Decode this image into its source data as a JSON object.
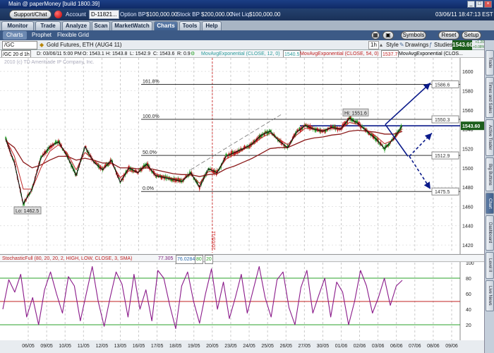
{
  "window": {
    "title": "Main @ paperMoney [build 1800.39]",
    "min": "_",
    "max": "□",
    "close": "×"
  },
  "account": {
    "support_label": "Support/Chat",
    "account_label": "Account",
    "account_value": "D-11821...",
    "option_bp_label": "Option BP",
    "option_bp_value": "$100,000.00",
    "stock_bp_label": "Stock BP",
    "stock_bp_value": "$200,000.00",
    "net_liq_label": "Net Liq",
    "net_liq_value": "$100,000.00",
    "datetime": "03/06/11 18:47:13 EST"
  },
  "tabs": [
    "Monitor",
    "Trade",
    "Analyze",
    "Scan",
    "MarketWatch",
    "Charts",
    "Tools",
    "Help"
  ],
  "active_tab": "Charts",
  "subtabs": [
    "Charts",
    "Prophet",
    "Flexible Grid"
  ],
  "right_buttons": {
    "symbols": "Symbols",
    "reset": "Reset",
    "setup": "Setup"
  },
  "toolbar": {
    "symbol": "/GC",
    "description": "Gold Futures, ETH (AUG4 11)",
    "timeframe": "1h",
    "style": "Style",
    "drawings": "Drawings",
    "studies": "Studies",
    "price": "1543.60",
    "change_up": "+1.20",
    "change_pct": "+0.08%"
  },
  "studyline": {
    "header": "/GC 20 d 1h",
    "date": "D: 03/06/11 5:00 PM",
    "open": "O: 1543.1",
    "high": "H: 1543.8",
    "low": "L: 1542.9",
    "close": "C: 1543.6",
    "range": "R: 0.9",
    "ema12_label": "MovAvgExponential (CLOSE, 12, 0)",
    "ema12_val": "1540.5",
    "ema54_label": "MovAvgExponential (CLOSE, 54, 0)",
    "ema54_val": "1537.7",
    "ema_more_label": "MovAvgExponential (CLOS..."
  },
  "copyright": "2010 (c) TD Ameritrade IP Company, Inc.",
  "annotations": {
    "fib_top": "161.8%",
    "fib_100": "100.0%",
    "fib_50": "50.0%",
    "fib_0": "0.0%",
    "low_label": "Lo: 1462.5",
    "high_label": "Hi: 1551.6",
    "vline_date": "20/05/11"
  },
  "level_tags": [
    "1586.6",
    "1550.3",
    "1512.9",
    "1475.5"
  ],
  "stoch_label": {
    "name": "StochasticFull (80, 20, 20, 2, HIGH, LOW, CLOSE, 3, SMA)",
    "k": "77.305",
    "d": "76.0284",
    "ob": "80",
    "os": "20"
  },
  "sidebar": [
    "Trade",
    "Times and Sales",
    "Active Trader",
    "Big Buttons",
    "Chart",
    "Dashboard",
    "Level II",
    "Live News"
  ],
  "chart_data": {
    "type": "candlestick",
    "x_ticks": [
      "06/05",
      "09/05",
      "10/05",
      "11/05",
      "12/05",
      "13/05",
      "16/05",
      "17/05",
      "18/05",
      "19/05",
      "20/05",
      "23/05",
      "24/05",
      "25/05",
      "26/05",
      "27/05",
      "30/05",
      "01/06",
      "02/06",
      "03/06",
      "06/06",
      "07/06",
      "08/06",
      "09/06"
    ],
    "y_ticks": [
      1420,
      1440,
      1460,
      1480,
      1500,
      1520,
      1540,
      1560,
      1580,
      1600
    ],
    "ylim": [
      1412,
      1614
    ],
    "fib_levels": [
      1586.6,
      1550.3,
      1512.9,
      1475.5
    ],
    "current_price": 1543.6,
    "price_path": [
      1530,
      1505,
      1462.5,
      1478,
      1510,
      1522,
      1527,
      1512,
      1492,
      1522,
      1506,
      1498,
      1508,
      1485,
      1500,
      1495,
      1504,
      1492,
      1490,
      1488,
      1486,
      1495,
      1480,
      1499,
      1495,
      1512,
      1516,
      1520,
      1525,
      1534,
      1538,
      1528,
      1521,
      1537,
      1544,
      1540,
      1538,
      1542,
      1540,
      1551.6,
      1546,
      1538,
      1530,
      1520,
      1530,
      1543.6
    ],
    "ema12_path": [
      1530,
      1512,
      1478,
      1478,
      1500,
      1517,
      1524,
      1515,
      1498,
      1516,
      1508,
      1500,
      1505,
      1490,
      1497,
      1495,
      1502,
      1494,
      1491,
      1489,
      1488,
      1493,
      1484,
      1496,
      1496,
      1509,
      1514,
      1519,
      1524,
      1531,
      1536,
      1530,
      1524,
      1534,
      1541,
      1540,
      1539,
      1541,
      1540,
      1547,
      1545,
      1539,
      1533,
      1525,
      1529,
      1540.5
    ],
    "ema54_path": [
      1528,
      1521,
      1506,
      1500,
      1503,
      1508,
      1512,
      1512,
      1508,
      1510,
      1508,
      1505,
      1505,
      1500,
      1500,
      1499,
      1500,
      1498,
      1496,
      1494,
      1493,
      1493,
      1491,
      1493,
      1494,
      1499,
      1502,
      1506,
      1510,
      1515,
      1520,
      1521,
      1521,
      1525,
      1529,
      1531,
      1532,
      1534,
      1535,
      1538,
      1539,
      1538,
      1537,
      1535,
      1535,
      1537.7
    ],
    "stoch_ylim": [
      0,
      100
    ],
    "stoch_ticks": [
      20,
      40,
      60,
      80,
      100
    ],
    "stoch_levels": [
      80,
      50,
      20
    ],
    "stoch_k": [
      40,
      78,
      62,
      85,
      30,
      55,
      20,
      65,
      88,
      60,
      35,
      82,
      70,
      25,
      60,
      95,
      50,
      18,
      55,
      88,
      72,
      30,
      85,
      40,
      65,
      25,
      90,
      80,
      45,
      15,
      70,
      88,
      50,
      22,
      60,
      92,
      40,
      75,
      28,
      55,
      85,
      35,
      65,
      95,
      55,
      30,
      78,
      88,
      42,
      20,
      68,
      90,
      35,
      58,
      80,
      30,
      75,
      62,
      20,
      50,
      90,
      70,
      35,
      55,
      80,
      45,
      70,
      77.3
    ]
  }
}
